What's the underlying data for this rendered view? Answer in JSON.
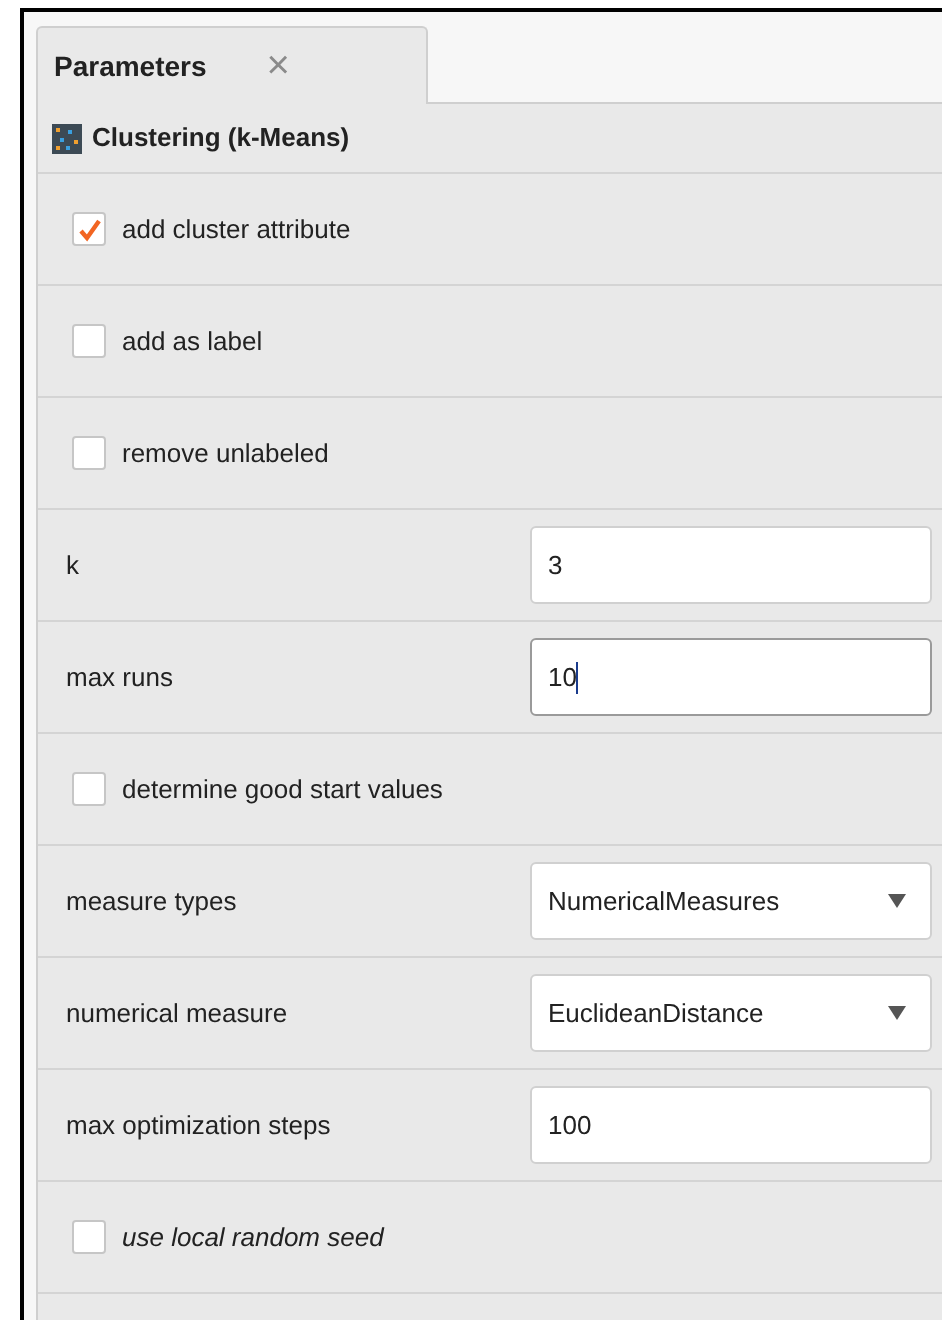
{
  "tab": {
    "label": "Parameters",
    "close": "×"
  },
  "operator": {
    "title": "Clustering (k-Means)"
  },
  "rows": [
    {
      "kind": "checkbox",
      "label": "add cluster attribute",
      "checked": true
    },
    {
      "kind": "checkbox",
      "label": "add as label",
      "checked": false
    },
    {
      "kind": "checkbox",
      "label": "remove unlabeled",
      "checked": false
    },
    {
      "kind": "text",
      "label": "k",
      "value": "3",
      "focused": false
    },
    {
      "kind": "text",
      "label": "max runs",
      "value": "10",
      "focused": true
    },
    {
      "kind": "checkbox",
      "label": "determine good start values",
      "checked": false
    },
    {
      "kind": "select",
      "label": "measure types",
      "value": "NumericalMeasures"
    },
    {
      "kind": "select",
      "label": "numerical measure",
      "value": "EuclideanDistance"
    },
    {
      "kind": "text",
      "label": "max optimization steps",
      "value": "100",
      "focused": false
    },
    {
      "kind": "checkbox",
      "label": "use local random seed",
      "checked": false,
      "italic": true
    }
  ]
}
